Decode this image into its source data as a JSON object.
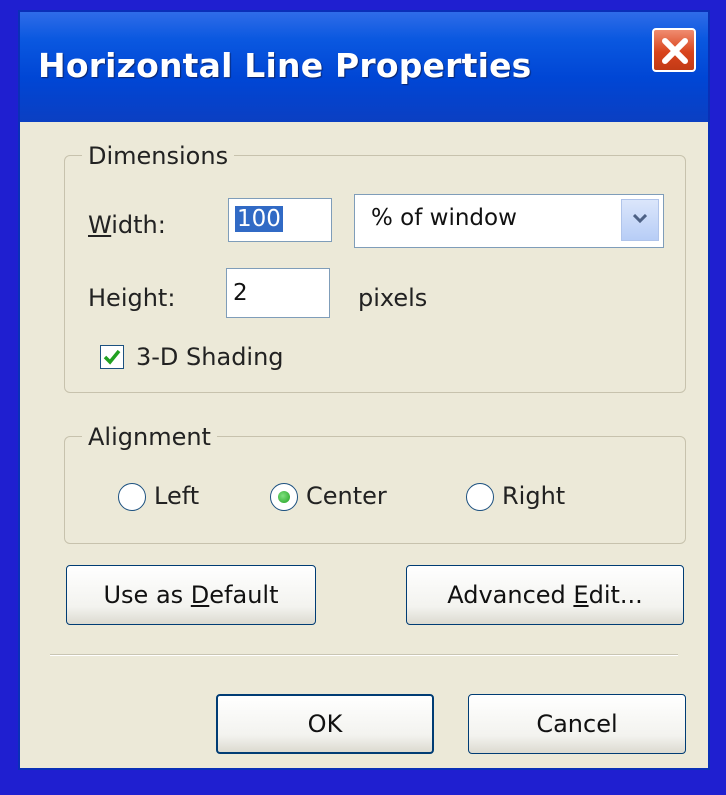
{
  "window": {
    "title": "Horizontal Line Properties"
  },
  "dimensions": {
    "legend": "Dimensions",
    "width_label_first": "W",
    "width_label_rest": "idth:",
    "width_value": "100",
    "width_unit": "% of window",
    "height_label": "Height:",
    "height_value": "2",
    "height_unit": "pixels",
    "shading_label": "3-D Shading",
    "shading_checked": true
  },
  "alignment": {
    "legend": "Alignment",
    "options": [
      {
        "label": "Left",
        "selected": false
      },
      {
        "label": "Center",
        "selected": true
      },
      {
        "label": "Right",
        "selected": false
      }
    ]
  },
  "buttons": {
    "default_pre": "Use as ",
    "default_u": "D",
    "default_post": "efault",
    "advanced_pre": "Advanced ",
    "advanced_u": "E",
    "advanced_post": "dit...",
    "ok": "OK",
    "cancel": "Cancel"
  },
  "colors": {
    "titlebar": "#0046d5",
    "dialog_bg": "#ece9d8",
    "desktop": "#1f1fd0"
  }
}
